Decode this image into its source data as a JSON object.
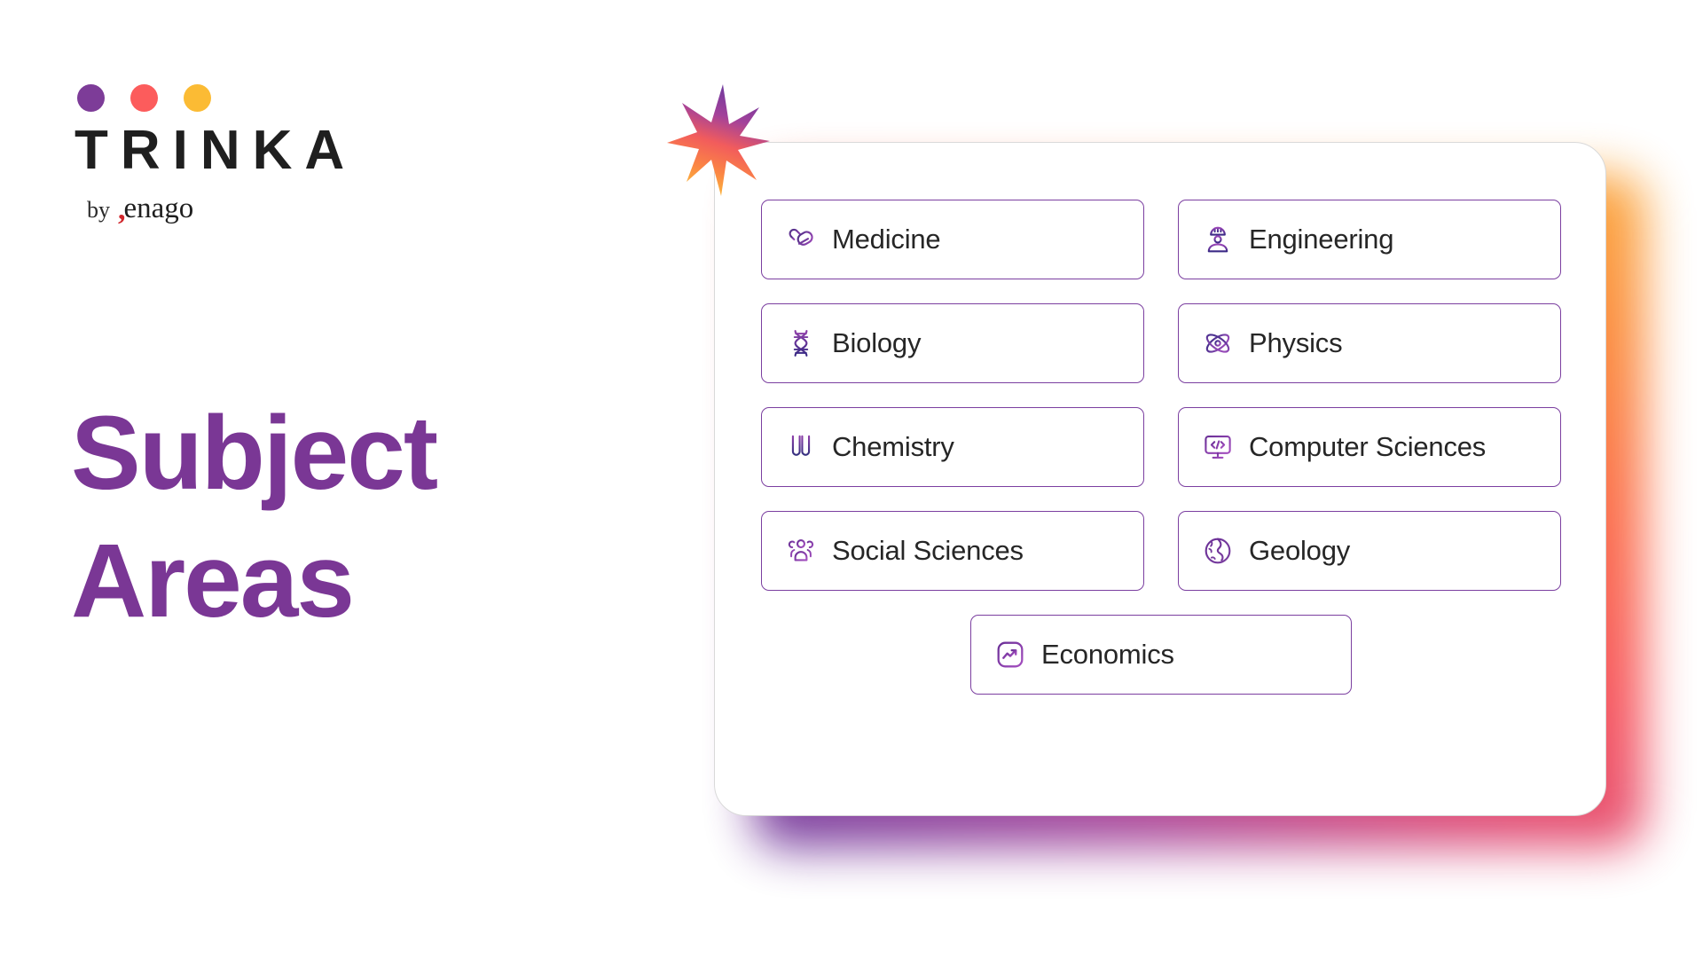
{
  "brand": {
    "wordmark": "TRINKA",
    "byline_prefix": "by",
    "byline_company": "enago",
    "dot_colors": [
      "#7D3C98",
      "#FC5C5C",
      "#FBBB34"
    ]
  },
  "headline": {
    "text": "Subject\nAreas",
    "color": "#7A3795"
  },
  "panel": {
    "accent_border": "#7B3FA0",
    "glow_colors": [
      "#FBA93C",
      "#FB6A4A",
      "#F6545C",
      "#A4449B",
      "#6D3A9E"
    ],
    "subjects": [
      {
        "label": "Medicine",
        "icon": "pills-icon"
      },
      {
        "label": "Engineering",
        "icon": "hard-hat-worker-icon"
      },
      {
        "label": "Biology",
        "icon": "dna-helix-icon"
      },
      {
        "label": "Physics",
        "icon": "atom-icon"
      },
      {
        "label": "Chemistry",
        "icon": "test-tubes-icon"
      },
      {
        "label": "Computer Sciences",
        "icon": "monitor-code-icon"
      },
      {
        "label": "Social Sciences",
        "icon": "people-group-icon"
      },
      {
        "label": "Geology",
        "icon": "globe-icon"
      },
      {
        "label": "Economics",
        "icon": "trend-up-chart-icon"
      }
    ]
  },
  "decoration": {
    "star": "eight-point-star-burst"
  }
}
